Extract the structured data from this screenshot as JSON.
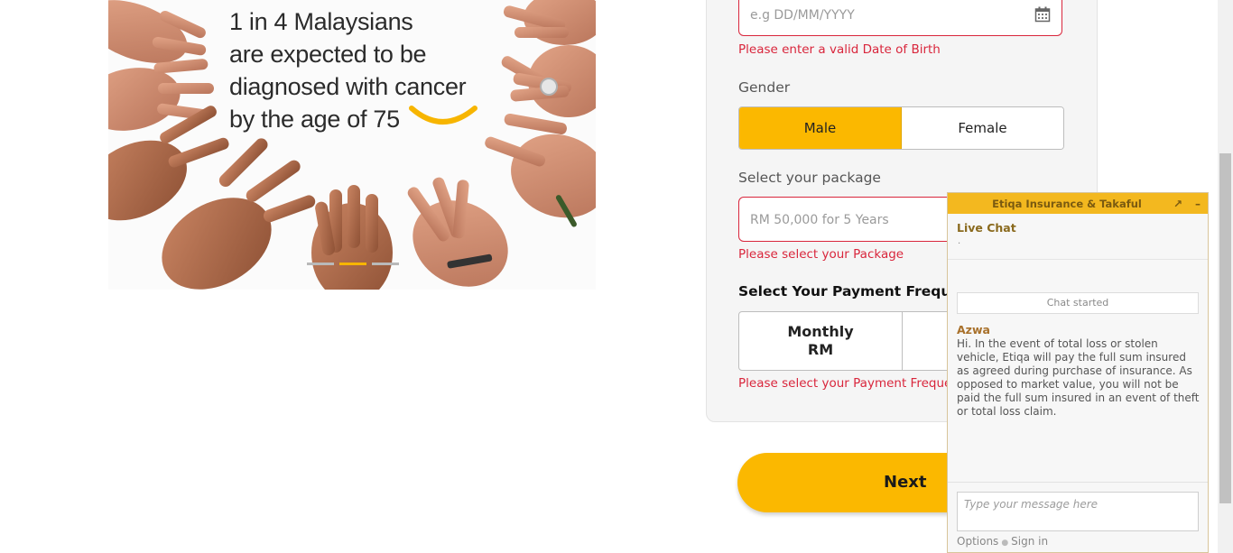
{
  "banner": {
    "lines": [
      "1 in 4 Malaysians",
      "are expected to be",
      "diagnosed with cancer",
      "by the age of 75"
    ],
    "carousel": {
      "slides": 3,
      "active": 2
    }
  },
  "form": {
    "dob": {
      "placeholder": "e.g DD/MM/YYYY",
      "error": "Please enter a valid Date of Birth"
    },
    "gender": {
      "label": "Gender",
      "options": [
        "Male",
        "Female"
      ],
      "selected": "Male"
    },
    "package": {
      "label": "Select your package",
      "placeholder": "RM 50,000 for 5 Years",
      "error": "Please select your Package"
    },
    "frequency": {
      "label": "Select Your Payment Frequency",
      "monthly_line1": "Monthly",
      "monthly_line2": "RM",
      "error": "Please select your Payment Frequency"
    },
    "next_label": "Next"
  },
  "chat": {
    "title": "Etiqa Insurance & Takaful",
    "popout_icon": "↗",
    "minimize_icon": "–",
    "live_label": "Live Chat",
    "live_sub": ".",
    "chat_started": "Chat started",
    "agent": "Azwa",
    "message": "Hi. In the event of total loss or stolen vehicle, Etiqa will pay the full sum insured as agreed during purchase of insurance. As opposed to market value, you will not be paid the full sum insured in an event of theft or total loss claim.",
    "input_placeholder": "Type your message here",
    "options_label": "Options",
    "signin_label": "Sign in"
  },
  "colors": {
    "accent": "#fbb800",
    "error": "#d9263c"
  }
}
